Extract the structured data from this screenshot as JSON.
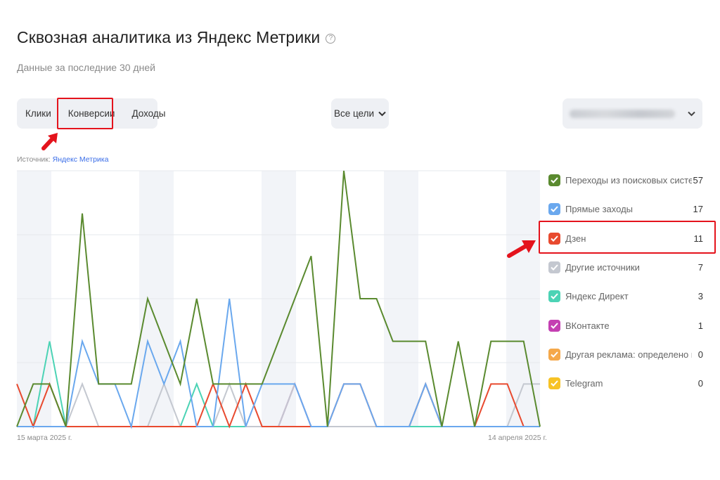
{
  "header": {
    "title": "Сквозная аналитика из Яндекс Метрики",
    "help_icon": "?",
    "subtitle": "Данные за последние 30 дней"
  },
  "tabs": [
    {
      "label": "Клики"
    },
    {
      "label": "Конверсии",
      "active": true
    },
    {
      "label": "Доходы"
    }
  ],
  "goals_select": {
    "label": "Все цели",
    "icon": "chevron-down-icon"
  },
  "account_select": {
    "value": "blurred",
    "icon": "chevron-down-icon"
  },
  "source": {
    "prefix": "Источник:",
    "link": "Яндекс Метрика"
  },
  "chart_data": {
    "type": "line",
    "x_start_label": "15 марта 2025 г.",
    "x_end_label": "14 апреля 2025 г.",
    "ylim": [
      0,
      6
    ],
    "series": [
      {
        "name": "Переходы из поисковых систем",
        "total": "57",
        "color": "#5a8a2f",
        "values": [
          0,
          1,
          1,
          0,
          5,
          1,
          1,
          1,
          3,
          2,
          1,
          3,
          1,
          1,
          1,
          1,
          2,
          3,
          4,
          0,
          6,
          3,
          3,
          2,
          2,
          2,
          0,
          2,
          0,
          2,
          2,
          2,
          0
        ]
      },
      {
        "name": "Прямые заходы",
        "total": "17",
        "color": "#6aa8ee",
        "values": [
          0,
          0,
          0,
          0,
          2,
          1,
          1,
          0,
          2,
          1,
          2,
          0,
          0,
          3,
          0,
          1,
          1,
          1,
          0,
          0,
          1,
          1,
          0,
          0,
          0,
          1,
          0,
          0,
          0,
          0,
          0,
          0,
          0
        ]
      },
      {
        "name": "Дзен",
        "total": "11",
        "color": "#e84a2f",
        "values": [
          1,
          0,
          1,
          0,
          0,
          0,
          0,
          0,
          0,
          0,
          0,
          0,
          1,
          0,
          1,
          0,
          0,
          0,
          0,
          0,
          1,
          1,
          0,
          0,
          0,
          1,
          0,
          0,
          0,
          1,
          1,
          0,
          0
        ]
      },
      {
        "name": "Другие источники",
        "total": "7",
        "color": "#c4c8d0",
        "values": [
          0,
          0,
          0,
          0,
          1,
          0,
          0,
          0,
          0,
          1,
          0,
          0,
          0,
          1,
          0,
          0,
          0,
          1,
          0,
          0,
          0,
          0,
          0,
          0,
          0,
          1,
          0,
          0,
          0,
          0,
          0,
          1,
          1
        ]
      },
      {
        "name": "Яндекс Директ",
        "total": "3",
        "color": "#4cd3b5",
        "values": [
          0,
          0,
          2,
          0,
          0,
          0,
          0,
          0,
          0,
          0,
          0,
          1,
          0,
          0,
          0,
          0,
          0,
          0,
          0,
          0,
          0,
          0,
          0,
          0,
          0,
          0,
          0,
          0,
          0,
          0,
          0,
          0,
          0
        ]
      },
      {
        "name": "ВКонтакте",
        "total": "1",
        "color": "#c43fb2",
        "values": [
          0,
          0,
          0,
          0,
          0,
          0,
          0,
          0,
          0,
          0,
          0,
          0,
          0,
          0,
          0,
          0,
          0,
          1,
          0,
          0,
          0,
          0,
          0,
          0,
          0,
          0,
          0,
          0,
          0,
          0,
          0,
          0,
          0
        ]
      },
      {
        "name": "Другая реклама: определено по ...",
        "total": "0",
        "color": "#f5a84a",
        "values": [
          0,
          0,
          0,
          0,
          0,
          0,
          0,
          0,
          0,
          0,
          0,
          0,
          0,
          0,
          0,
          0,
          0,
          0,
          0,
          0,
          0,
          0,
          0,
          0,
          0,
          0,
          0,
          0,
          0,
          0,
          0,
          0,
          0
        ]
      },
      {
        "name": "Telegram",
        "total": "0",
        "color": "#f7c325",
        "values": [
          0,
          0,
          0,
          0,
          0,
          0,
          0,
          0,
          0,
          0,
          0,
          0,
          0,
          0,
          0,
          0,
          0,
          0,
          0,
          0,
          0,
          0,
          0,
          0,
          0,
          0,
          0,
          0,
          0,
          0,
          0,
          0,
          0
        ]
      }
    ]
  }
}
